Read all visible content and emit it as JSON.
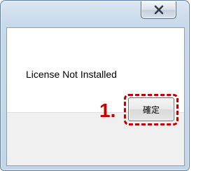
{
  "window": {
    "close_icon": "close-icon",
    "close_icon_color": "#2f3b4c",
    "frame_color": "#c8d9ea"
  },
  "dialog": {
    "message": "License Not Installed",
    "ok_label": "確定"
  },
  "annotation": {
    "step_label": "1.",
    "highlight_color": "#c00000"
  }
}
